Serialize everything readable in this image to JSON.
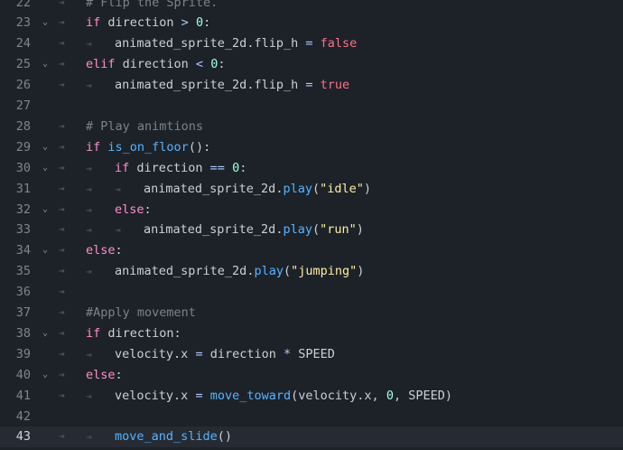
{
  "editor": {
    "lines": [
      {
        "num": "22",
        "fold": "",
        "bars": 1,
        "tokens": [
          {
            "t": "# Flip the Sprite.",
            "c": "cmt"
          }
        ]
      },
      {
        "num": "23",
        "fold": "⌄",
        "bars": 1,
        "tokens": [
          {
            "t": "if",
            "c": "ctl"
          },
          {
            "t": " direction ",
            "c": "id"
          },
          {
            "t": ">",
            "c": "op"
          },
          {
            "t": " ",
            "c": "id"
          },
          {
            "t": "0",
            "c": "num"
          },
          {
            "t": ":",
            "c": "sym"
          }
        ]
      },
      {
        "num": "24",
        "fold": "",
        "bars": 2,
        "tokens": [
          {
            "t": "animated_sprite_2d",
            "c": "id"
          },
          {
            "t": ".",
            "c": "sym"
          },
          {
            "t": "flip_h",
            "c": "id"
          },
          {
            "t": " ",
            "c": "id"
          },
          {
            "t": "=",
            "c": "op"
          },
          {
            "t": " ",
            "c": "id"
          },
          {
            "t": "false",
            "c": "kw"
          }
        ]
      },
      {
        "num": "25",
        "fold": "⌄",
        "bars": 1,
        "tokens": [
          {
            "t": "elif",
            "c": "ctl"
          },
          {
            "t": " direction ",
            "c": "id"
          },
          {
            "t": "<",
            "c": "op"
          },
          {
            "t": " ",
            "c": "id"
          },
          {
            "t": "0",
            "c": "num"
          },
          {
            "t": ":",
            "c": "sym"
          }
        ]
      },
      {
        "num": "26",
        "fold": "",
        "bars": 2,
        "tokens": [
          {
            "t": "animated_sprite_2d",
            "c": "id"
          },
          {
            "t": ".",
            "c": "sym"
          },
          {
            "t": "flip_h",
            "c": "id"
          },
          {
            "t": " ",
            "c": "id"
          },
          {
            "t": "=",
            "c": "op"
          },
          {
            "t": " ",
            "c": "id"
          },
          {
            "t": "true",
            "c": "kw"
          }
        ]
      },
      {
        "num": "27",
        "fold": "",
        "bars": 0,
        "tokens": []
      },
      {
        "num": "28",
        "fold": "",
        "bars": 1,
        "tokens": [
          {
            "t": "# Play animtions",
            "c": "cmt"
          }
        ]
      },
      {
        "num": "29",
        "fold": "⌄",
        "bars": 1,
        "tokens": [
          {
            "t": "if",
            "c": "ctl"
          },
          {
            "t": " ",
            "c": "id"
          },
          {
            "t": "is_on_floor",
            "c": "fn"
          },
          {
            "t": "():",
            "c": "sym"
          }
        ]
      },
      {
        "num": "30",
        "fold": "⌄",
        "bars": 2,
        "tokens": [
          {
            "t": "if",
            "c": "ctl"
          },
          {
            "t": " direction ",
            "c": "id"
          },
          {
            "t": "==",
            "c": "op"
          },
          {
            "t": " ",
            "c": "id"
          },
          {
            "t": "0",
            "c": "num"
          },
          {
            "t": ":",
            "c": "sym"
          }
        ]
      },
      {
        "num": "31",
        "fold": "",
        "bars": 3,
        "tokens": [
          {
            "t": "animated_sprite_2d",
            "c": "id"
          },
          {
            "t": ".",
            "c": "sym"
          },
          {
            "t": "play",
            "c": "fn"
          },
          {
            "t": "(",
            "c": "sym"
          },
          {
            "t": "\"idle\"",
            "c": "str"
          },
          {
            "t": ")",
            "c": "sym"
          }
        ]
      },
      {
        "num": "32",
        "fold": "⌄",
        "bars": 2,
        "tokens": [
          {
            "t": "else",
            "c": "ctl"
          },
          {
            "t": ":",
            "c": "sym"
          }
        ]
      },
      {
        "num": "33",
        "fold": "",
        "bars": 3,
        "tokens": [
          {
            "t": "animated_sprite_2d",
            "c": "id"
          },
          {
            "t": ".",
            "c": "sym"
          },
          {
            "t": "play",
            "c": "fn"
          },
          {
            "t": "(",
            "c": "sym"
          },
          {
            "t": "\"run\"",
            "c": "str"
          },
          {
            "t": ")",
            "c": "sym"
          }
        ]
      },
      {
        "num": "34",
        "fold": "⌄",
        "bars": 1,
        "tokens": [
          {
            "t": "else",
            "c": "ctl"
          },
          {
            "t": ":",
            "c": "sym"
          }
        ]
      },
      {
        "num": "35",
        "fold": "",
        "bars": 2,
        "tokens": [
          {
            "t": "animated_sprite_2d",
            "c": "id"
          },
          {
            "t": ".",
            "c": "sym"
          },
          {
            "t": "play",
            "c": "fn"
          },
          {
            "t": "(",
            "c": "sym"
          },
          {
            "t": "\"jumping\"",
            "c": "str"
          },
          {
            "t": ")",
            "c": "sym"
          }
        ]
      },
      {
        "num": "36",
        "fold": "",
        "bars": 1,
        "tokens": []
      },
      {
        "num": "37",
        "fold": "",
        "bars": 1,
        "tokens": [
          {
            "t": "#Apply movement",
            "c": "cmt"
          }
        ]
      },
      {
        "num": "38",
        "fold": "⌄",
        "bars": 1,
        "tokens": [
          {
            "t": "if",
            "c": "ctl"
          },
          {
            "t": " direction",
            "c": "id"
          },
          {
            "t": ":",
            "c": "sym"
          }
        ]
      },
      {
        "num": "39",
        "fold": "",
        "bars": 2,
        "tokens": [
          {
            "t": "velocity",
            "c": "id"
          },
          {
            "t": ".",
            "c": "sym"
          },
          {
            "t": "x",
            "c": "id"
          },
          {
            "t": " ",
            "c": "id"
          },
          {
            "t": "=",
            "c": "op"
          },
          {
            "t": " direction ",
            "c": "id"
          },
          {
            "t": "*",
            "c": "op"
          },
          {
            "t": " SPEED",
            "c": "const"
          }
        ]
      },
      {
        "num": "40",
        "fold": "⌄",
        "bars": 1,
        "tokens": [
          {
            "t": "else",
            "c": "ctl"
          },
          {
            "t": ":",
            "c": "sym"
          }
        ]
      },
      {
        "num": "41",
        "fold": "",
        "bars": 2,
        "tokens": [
          {
            "t": "velocity",
            "c": "id"
          },
          {
            "t": ".",
            "c": "sym"
          },
          {
            "t": "x",
            "c": "id"
          },
          {
            "t": " ",
            "c": "id"
          },
          {
            "t": "=",
            "c": "op"
          },
          {
            "t": " ",
            "c": "id"
          },
          {
            "t": "move_toward",
            "c": "fn"
          },
          {
            "t": "(velocity.x, ",
            "c": "sym"
          },
          {
            "t": "0",
            "c": "num"
          },
          {
            "t": ", SPEED)",
            "c": "sym"
          }
        ]
      },
      {
        "num": "42",
        "fold": "",
        "bars": 0,
        "tokens": []
      },
      {
        "num": "43",
        "fold": "",
        "bars": 2,
        "current": true,
        "tokens": [
          {
            "t": "move_and_slide",
            "c": "fn"
          },
          {
            "t": "()",
            "c": "sym"
          }
        ]
      }
    ],
    "colors": {
      "background": "#1d2229",
      "current_line": "#262b33",
      "keyword": "#ff7085",
      "control_flow": "#ff8ccc",
      "function": "#57b3ff",
      "number": "#a1ffe0",
      "string": "#ffeda1",
      "comment": "#7d828a"
    },
    "icons": {
      "fold": "chevron-down-icon",
      "indent": "indent-tab-icon"
    }
  }
}
